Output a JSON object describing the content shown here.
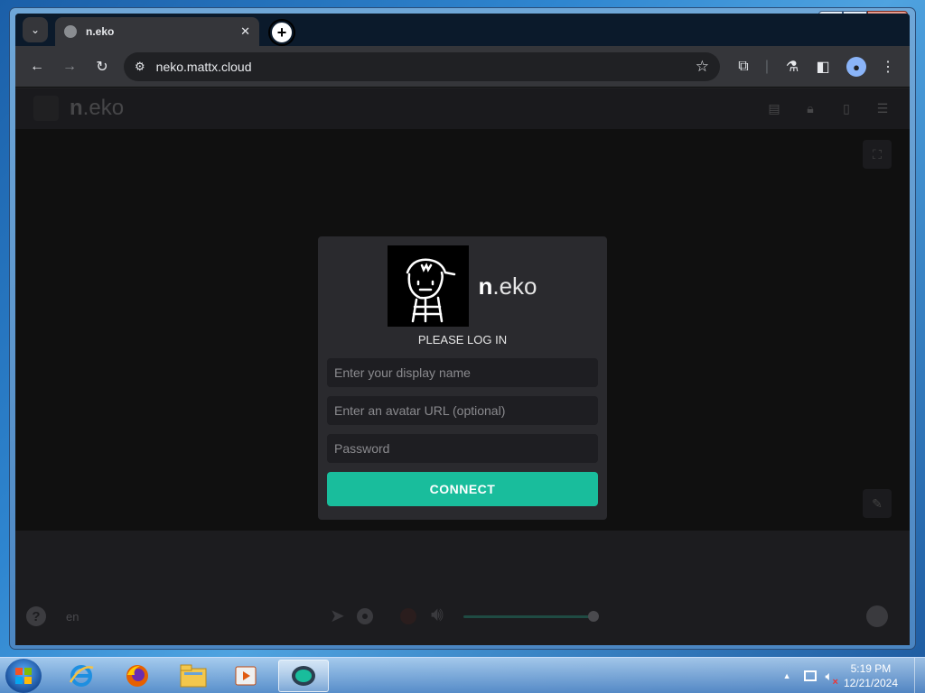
{
  "browser": {
    "tab_title": "n.eko",
    "tab_close": "✕",
    "new_tab": "+",
    "url": "neko.mattx.cloud"
  },
  "app": {
    "brand_prefix": "n",
    "brand_suffix": ".eko",
    "language": "en"
  },
  "login": {
    "brand_prefix": "n",
    "brand_suffix": ".eko",
    "title": "PLEASE LOG IN",
    "display_name_placeholder": "Enter your display name",
    "avatar_placeholder": "Enter an avatar URL (optional)",
    "password_placeholder": "Password",
    "connect_label": "CONNECT"
  },
  "player": {
    "volume_level": 1.0
  },
  "taskbar": {
    "time": "5:19 PM",
    "date": "12/21/2024",
    "apps": [
      "internet-explorer",
      "firefox",
      "file-explorer",
      "media-player",
      "neko-client"
    ]
  },
  "colors": {
    "accent": "#19bd9c",
    "card": "#2a2a2e",
    "field": "#1e1e22"
  }
}
